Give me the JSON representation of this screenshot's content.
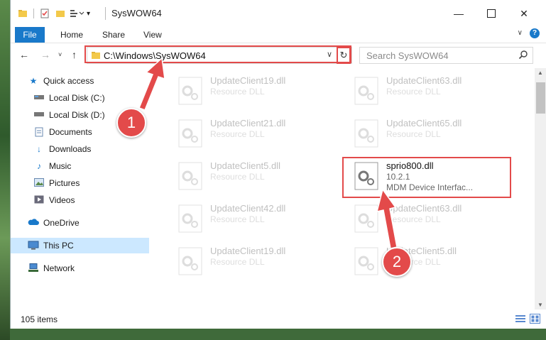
{
  "window": {
    "title": "SysWOW64"
  },
  "ribbon": {
    "tabs": [
      "File",
      "Home",
      "Share",
      "View"
    ]
  },
  "address": {
    "path": "C:\\Windows\\SysWOW64"
  },
  "search": {
    "placeholder": "Search SysWOW64"
  },
  "nav": {
    "items": [
      {
        "label": "Quick access",
        "icon": "star-icon"
      },
      {
        "label": "Local Disk (C:)",
        "icon": "drive-icon"
      },
      {
        "label": "Local Disk (D:)",
        "icon": "drive-icon"
      },
      {
        "label": "Documents",
        "icon": "documents-icon",
        "pinned": true
      },
      {
        "label": "Downloads",
        "icon": "downloads-icon",
        "pinned": true
      },
      {
        "label": "Music",
        "icon": "music-icon",
        "pinned": true
      },
      {
        "label": "Pictures",
        "icon": "pictures-icon",
        "pinned": true
      },
      {
        "label": "Videos",
        "icon": "videos-icon",
        "pinned": true
      },
      {
        "label": "OneDrive",
        "icon": "cloud-icon"
      },
      {
        "label": "This PC",
        "icon": "pc-icon",
        "selected": true
      },
      {
        "label": "Network",
        "icon": "network-icon"
      }
    ]
  },
  "files": {
    "left": [
      {
        "name": "UpdateClient19.dll",
        "type": "Resource DLL"
      },
      {
        "name": "UpdateClient21.dll",
        "type": "Resource DLL"
      },
      {
        "name": "UpdateClient5.dll",
        "type": "Resource DLL"
      },
      {
        "name": "UpdateClient42.dll",
        "type": "Resource DLL"
      },
      {
        "name": "UpdateClient19.dll",
        "type": "Resource DLL"
      }
    ],
    "right": [
      {
        "name": "UpdateClient63.dll",
        "type": "Resource DLL"
      },
      {
        "name": "UpdateClient65.dll",
        "type": "Resource DLL"
      },
      {
        "name": "sprio800.dll",
        "version": "10.2.1",
        "type": "MDM Device Interfac...",
        "highlighted": true
      },
      {
        "name": "UpdateClient63.dll",
        "type": "Resource DLL"
      },
      {
        "name": "UpdateClient5.dll",
        "type": "Resource DLL"
      }
    ]
  },
  "status": {
    "item_count": "105 items"
  },
  "annotations": {
    "badge1": "1",
    "badge2": "2"
  },
  "colors": {
    "highlight": "#e34a4a",
    "accent": "#1979ca"
  }
}
